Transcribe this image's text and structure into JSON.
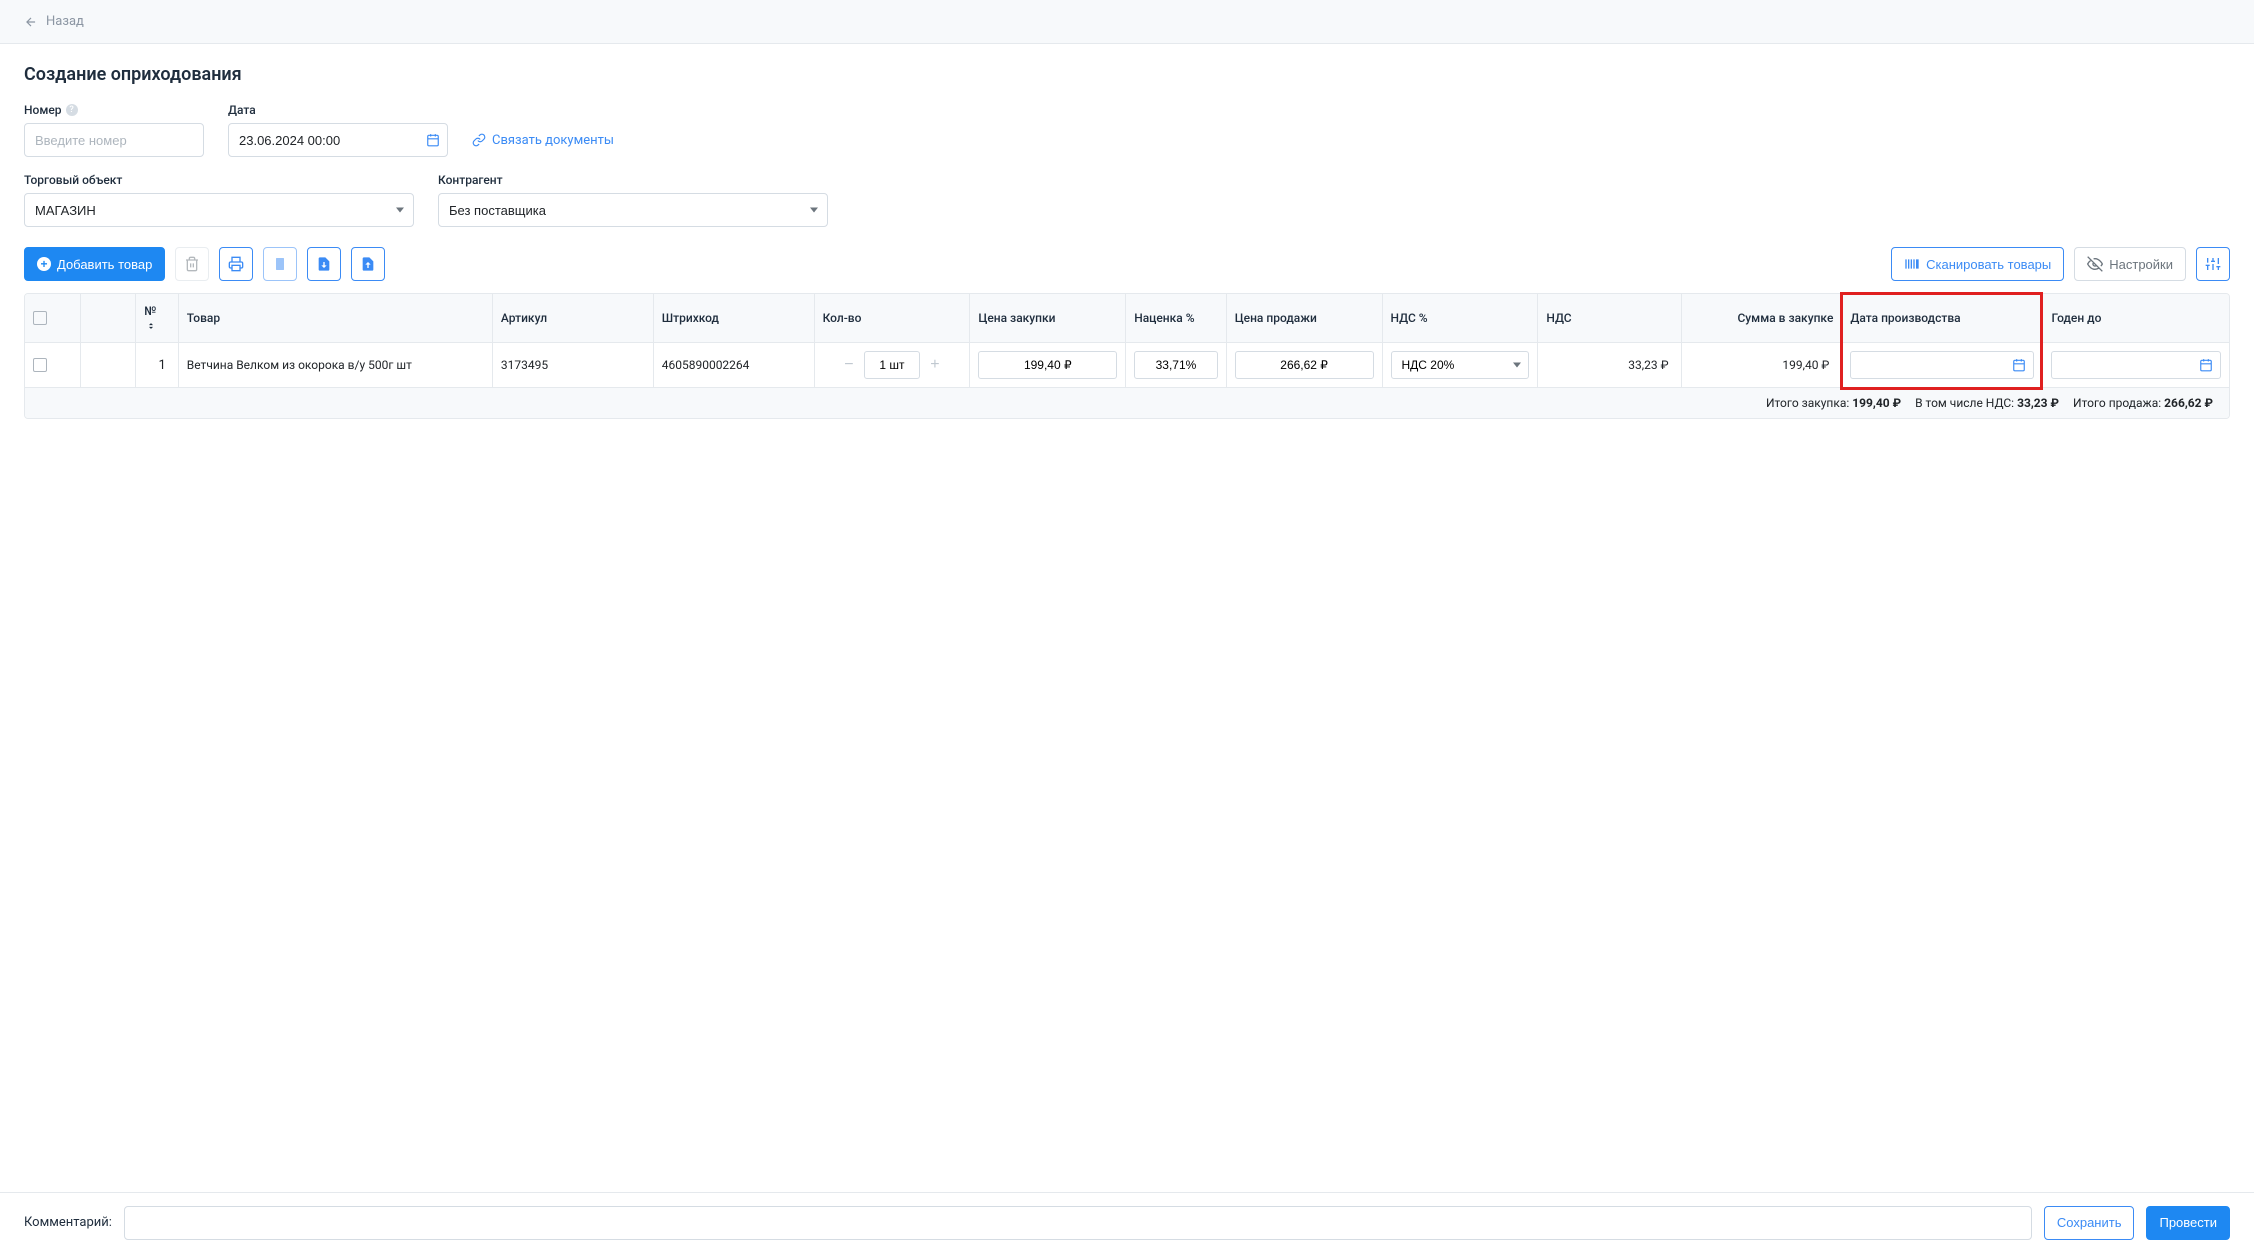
{
  "header": {
    "back_label": "Назад"
  },
  "page": {
    "title": "Создание оприходования"
  },
  "form": {
    "number": {
      "label": "Номер",
      "placeholder": "Введите номер",
      "value": ""
    },
    "date": {
      "label": "Дата",
      "value": "23.06.2024 00:00"
    },
    "link_docs_label": "Связать документы",
    "trade_object": {
      "label": "Торговый объект",
      "value": "МАГАЗИН"
    },
    "counterparty": {
      "label": "Контрагент",
      "value": "Без поставщика"
    }
  },
  "toolbar": {
    "add_label": "Добавить товар",
    "scan_label": "Сканировать товары",
    "settings_label": "Настройки"
  },
  "table": {
    "headers": {
      "num": "№",
      "name": "Товар",
      "article": "Артикул",
      "barcode": "Штрихкод",
      "qty": "Кол-во",
      "purchase_price": "Цена закупки",
      "markup": "Наценка %",
      "sale_price": "Цена продажи",
      "vat_pct": "НДС %",
      "vat": "НДС",
      "sum": "Сумма в закупке",
      "mfg_date": "Дата производства",
      "exp_date": "Годен до"
    },
    "rows": [
      {
        "num": "1",
        "name": "Ветчина Велком из окорока в/у 500г шт",
        "article": "3173495",
        "barcode": "4605890002264",
        "qty": "1 шт",
        "purchase_price": "199,40 ₽",
        "markup": "33,71%",
        "sale_price": "266,62 ₽",
        "vat_pct": "НДС 20%",
        "vat": "33,23 ₽",
        "sum": "199,40 ₽",
        "mfg_date": "",
        "exp_date": ""
      }
    ],
    "footer": {
      "total_purchase_label": "Итого закупка:",
      "total_purchase_value": "199,40 ₽",
      "total_vat_label": "В том числе НДС:",
      "total_vat_value": "33,23 ₽",
      "total_sale_label": "Итого продажа:",
      "total_sale_value": "266,62 ₽"
    }
  },
  "bottom": {
    "comment_label": "Комментарий:",
    "save_label": "Сохранить",
    "submit_label": "Провести"
  }
}
